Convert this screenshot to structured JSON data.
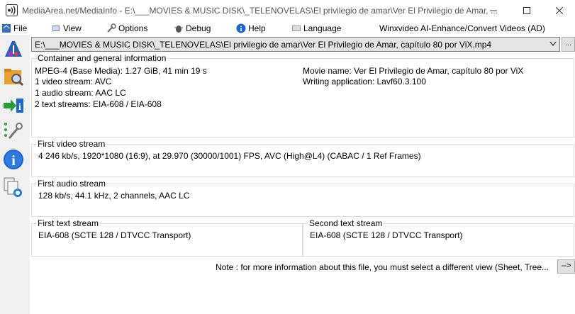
{
  "window": {
    "title": "MediaArea.net/MediaInfo - E:\\___MOVIES & MUSIC DISK\\_TELENOVELAS\\El privilegio de amar\\Ver El Privilegio de Amar, ..."
  },
  "menu": {
    "file": "File",
    "view": "View",
    "options": "Options",
    "debug": "Debug",
    "help": "Help",
    "language": "Language",
    "winx": "Winxvideo AI-Enhance/Convert Videos (AD)"
  },
  "file_selector": {
    "value": "E:\\___MOVIES & MUSIC DISK\\_TELENOVELAS\\El privilegio de amar\\Ver El Privilegio de Amar, capítulo 80 por ViX.mp4",
    "browse_label": "..."
  },
  "general": {
    "heading": "Container and general information",
    "format": "MPEG-4 (Base Media): 1.27 GiB, 41 min 19 s",
    "video_count": "1 video stream: AVC",
    "audio_count": "1 audio stream: AAC LC",
    "text_count": "2 text streams: EIA-608 / EIA-608",
    "movie_name": "Movie name: Ver El Privilegio de Amar, capítulo 80 por ViX",
    "writing_app": "Writing application: Lavf60.3.100"
  },
  "video": {
    "heading": "First video stream",
    "info": "4 246 kb/s, 1920*1080 (16:9), at 29.970 (30000/1001) FPS, AVC (High@L4) (CABAC / 1 Ref Frames)"
  },
  "audio": {
    "heading": "First audio stream",
    "info": "128 kb/s, 44.1 kHz, 2 channels, AAC LC"
  },
  "text1": {
    "heading": "First text stream",
    "info": "EIA-608 (SCTE 128 / DTVCC Transport)"
  },
  "text2": {
    "heading": "Second text stream",
    "info": "EIA-608 (SCTE 128 / DTVCC Transport)"
  },
  "note": {
    "text": "Note : for more information about this file, you must select a different view (Sheet, Tree...",
    "button_label": "-->"
  },
  "toolbar_icons": [
    "open-file-icon",
    "open-folder-icon",
    "export-icon",
    "preferences-icon",
    "about-icon",
    "multiple-files-icon"
  ]
}
